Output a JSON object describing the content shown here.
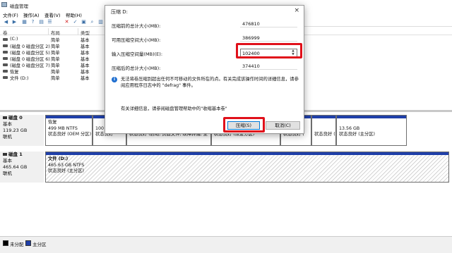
{
  "window": {
    "title": "磁盘管理"
  },
  "menu": [
    "文件(F)",
    "操作(A)",
    "查看(V)",
    "帮助(H)"
  ],
  "volume_list": {
    "columns": [
      "卷",
      "布局",
      "类型"
    ],
    "rows": [
      {
        "name": "(C:)",
        "layout": "简单",
        "type": "基本"
      },
      {
        "name": "(磁盘 0 磁盘分区 2)",
        "layout": "简单",
        "type": "基本"
      },
      {
        "name": "(磁盘 0 磁盘分区 5)",
        "layout": "简单",
        "type": "基本"
      },
      {
        "name": "(磁盘 0 磁盘分区 6)",
        "layout": "简单",
        "type": "基本"
      },
      {
        "name": "(磁盘 0 磁盘分区 7)",
        "layout": "简单",
        "type": "基本"
      },
      {
        "name": "恢复",
        "layout": "简单",
        "type": "基本"
      },
      {
        "name": "文件 (D:)",
        "layout": "简单",
        "type": "基本"
      }
    ]
  },
  "disks": [
    {
      "name": "磁盘 0",
      "type": "基本",
      "size": "119.23 GB",
      "status": "联机",
      "partitions": [
        {
          "title": "恢复",
          "size": "499 MB NTFS",
          "status": "状态良好 (OEM 分区)"
        },
        {
          "title": "",
          "size": "100 M",
          "status": "状态良好"
        },
        {
          "title": "",
          "size": "",
          "status": "状态良好 (启动, 页面文件, 故障转储, 主"
        },
        {
          "title": "",
          "size": "",
          "status": "状态良好 (恢复分区)"
        },
        {
          "title": "",
          "size": "",
          "status": "状态良好 ("
        },
        {
          "title": "",
          "size": "",
          "status": "状态良好 ("
        },
        {
          "title": "",
          "size": "13.56 GB",
          "status": "状态良好 (主分区)"
        }
      ]
    },
    {
      "name": "磁盘 1",
      "type": "基本",
      "size": "465.64 GB",
      "status": "联机",
      "partitions": [
        {
          "title": "文件  (D:)",
          "size": "465.63 GB NTFS",
          "status": "状态良好 (主分区)"
        }
      ]
    }
  ],
  "legend": [
    {
      "label": "未分配",
      "color": "#000000"
    },
    {
      "label": "主分区",
      "color": "#1f3fa8"
    }
  ],
  "dialog": {
    "title": "压缩 D:",
    "total_before_label": "压缩前的总计大小(MB):",
    "total_before_value": "476810",
    "available_label": "可用压缩空间大小(MB):",
    "available_value": "386999",
    "input_label": "输入压缩空间量(MB)(E):",
    "input_value": "102400",
    "total_after_label": "压缩后的总计大小(MB):",
    "total_after_value": "374410",
    "info_text": "无法将卷压缩到超出任何不可移动的文件所在的点。有关完成该操作时间的详细信息，请参阅应用程序日志中的 \"defrag\" 事件。",
    "more_info": "有关详细信息，请参阅磁盘管理帮助中的\"收缩基本卷\"",
    "shrink_button": "压缩(S)",
    "cancel_button": "取消(C)"
  },
  "colors": {
    "highlight": "#e0101a",
    "primary_partition": "#1f3fa8"
  }
}
